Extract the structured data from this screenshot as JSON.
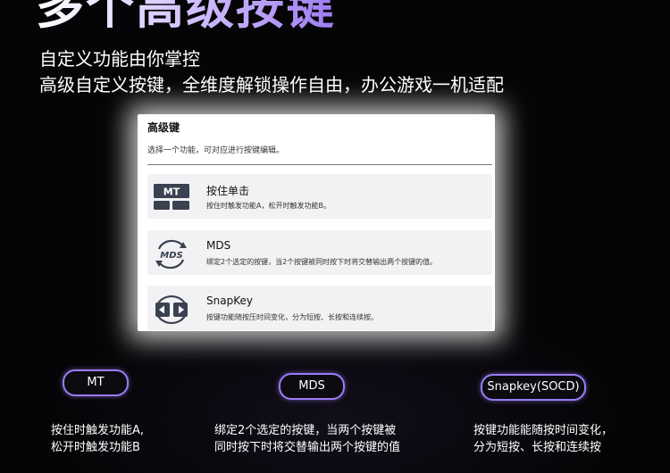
{
  "hero": {
    "title": "多个高级按键",
    "subtitle_1": "自定义功能由你掌控",
    "subtitle_2": "高级自定义按键，全维度解锁操作自由，办公游戏一机适配"
  },
  "panel": {
    "title": "高级键",
    "description": "选择一个功能，可对应进行按键编辑。",
    "options": [
      {
        "name": "按住单击",
        "description": "按住时触发功能A，松开时触发功能B。",
        "icon": "mt-keycap-icon",
        "icon_text": "MT"
      },
      {
        "name": "MDS",
        "description": "绑定2个选定的按键，当2个按键被同时按下时将交替输出两个按键的值。",
        "icon": "mds-cycle-icon",
        "icon_text": "MDS"
      },
      {
        "name": "SnapKey",
        "description": "按键功能随按压时间变化，分为短按、长按和连续按。",
        "icon": "snapkey-arrows-icon"
      }
    ]
  },
  "features": [
    {
      "label": "MT",
      "line_1": "按住时触发功能A,",
      "line_2": "松开时触发功能B"
    },
    {
      "label": "MDS",
      "line_1": "绑定2个选定的按键，当两个按键被",
      "line_2": "同时按下时将交替输出两个按键的值"
    },
    {
      "label": "Snapkey(SOCD)",
      "line_1": "按键功能能随按时间变化，",
      "line_2": "分为短按、长按和连续按"
    }
  ],
  "colors": {
    "background": "#050507",
    "accent_purple": "#9b7bf5",
    "icon_dark": "#3a4150"
  }
}
